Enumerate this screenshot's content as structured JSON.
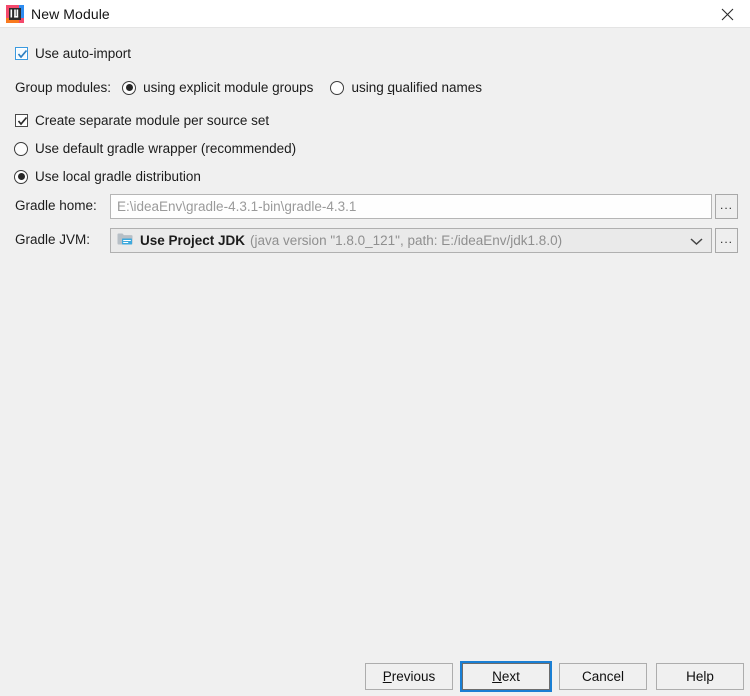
{
  "window": {
    "title": "New Module",
    "app_icon": "intellij-idea-icon",
    "close_icon": "close-icon"
  },
  "options": {
    "auto_import": {
      "label": "Use auto-import",
      "checked": true,
      "focused": true
    },
    "group_modules": {
      "label": "Group modules:",
      "choices": [
        {
          "label_before": "using explicit module ",
          "mnemonic": "g",
          "label_after": "roups",
          "selected": true
        },
        {
          "label_before": "using ",
          "mnemonic": "q",
          "label_after": "ualified names",
          "selected": false
        }
      ]
    },
    "separate_module": {
      "label": "Create separate module per source set",
      "checked": true
    },
    "distribution": {
      "choices": [
        {
          "label": "Use default gradle wrapper (recommended)",
          "selected": false
        },
        {
          "label": "Use local gradle distribution",
          "selected": true
        }
      ]
    }
  },
  "gradle_home": {
    "label": "Gradle home:",
    "value": "E:\\ideaEnv\\gradle-4.3.1-bin\\gradle-4.3.1",
    "browse_label": "...",
    "browse_icon": "ellipsis-icon"
  },
  "gradle_jvm": {
    "label": "Gradle JVM:",
    "icon": "jdk-folder-icon",
    "value_primary": "Use Project JDK",
    "value_secondary": "(java version \"1.8.0_121\", path: E:/ideaEnv/jdk1.8.0)",
    "dropdown_icon": "chevron-down-icon",
    "browse_label": "...",
    "browse_icon": "ellipsis-icon"
  },
  "footer": {
    "previous": {
      "before": "",
      "mnemonic": "P",
      "after": "revious"
    },
    "next": {
      "before": "",
      "mnemonic": "N",
      "after": "ext",
      "focused": true
    },
    "cancel": {
      "label": "Cancel"
    },
    "help": {
      "label": "Help"
    }
  },
  "colors": {
    "dialog_bg": "#f0f0f0",
    "titlebar_bg": "#ffffff",
    "focus_blue": "#1a7fd4",
    "checkbox_focus_blue": "#3a9ae0",
    "field_bg": "#fefefe",
    "combo_bg": "#eaeaea",
    "placeholder_text": "#9a9a9a"
  }
}
